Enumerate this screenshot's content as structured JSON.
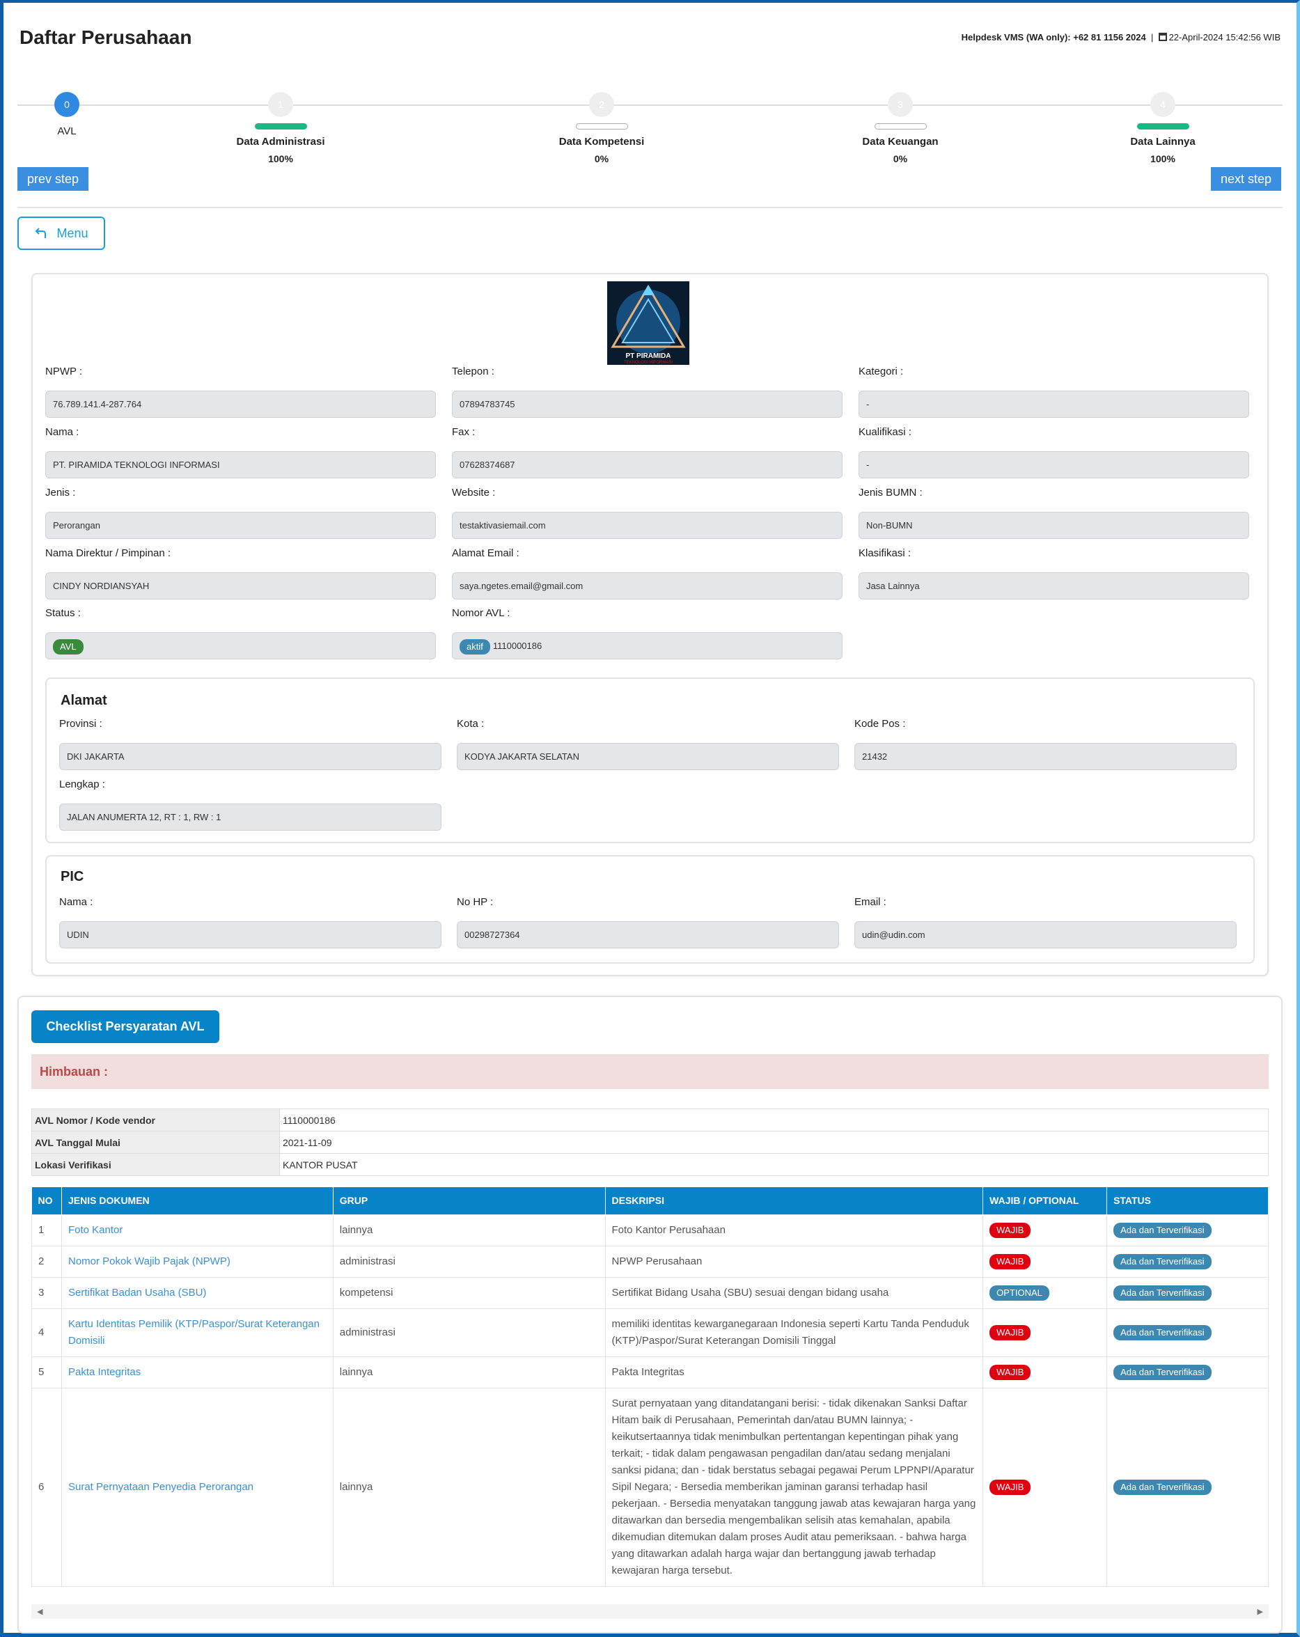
{
  "header": {
    "title": "Daftar Perusahaan",
    "helpdesk": "Helpdesk VMS (WA only): +62 81 1156 2024",
    "separator": "|",
    "datetime": "22-April-2024 15:42:56 WIB"
  },
  "stepper": {
    "steps": [
      {
        "num": "0",
        "label": "AVL",
        "percent": "",
        "progress": null,
        "active": true
      },
      {
        "num": "1",
        "label": "Data Administrasi",
        "percent": "100%",
        "progress": 100
      },
      {
        "num": "2",
        "label": "Data Kompetensi",
        "percent": "0%",
        "progress": 0
      },
      {
        "num": "3",
        "label": "Data Keuangan",
        "percent": "0%",
        "progress": 0
      },
      {
        "num": "4",
        "label": "Data Lainnya",
        "percent": "100%",
        "progress": 100
      }
    ],
    "prev": "prev step",
    "next": "next step"
  },
  "menu_label": "Menu",
  "logo": {
    "name": "PT PIRAMIDA",
    "sub": "TEKNOLOGI INFORMASI"
  },
  "company": {
    "npwp": {
      "label": "NPWP :",
      "value": "76.789.141.4-287.764"
    },
    "telepon": {
      "label": "Telepon :",
      "value": "07894783745"
    },
    "kategori": {
      "label": "Kategori :",
      "value": "-"
    },
    "nama": {
      "label": "Nama :",
      "value": "PT. PIRAMIDA TEKNOLOGI INFORMASI"
    },
    "fax": {
      "label": "Fax :",
      "value": "07628374687"
    },
    "kualifikasi": {
      "label": "Kualifikasi :",
      "value": "-"
    },
    "jenis": {
      "label": "Jenis :",
      "value": "Perorangan"
    },
    "website": {
      "label": "Website :",
      "value": "testaktivasiemail.com"
    },
    "jenis_bumn": {
      "label": "Jenis BUMN :",
      "value": "Non-BUMN"
    },
    "direktur": {
      "label": "Nama Direktur / Pimpinan :",
      "value": "CINDY NORDIANSYAH"
    },
    "email": {
      "label": "Alamat Email :",
      "value": "saya.ngetes.email@gmail.com"
    },
    "klasifikasi": {
      "label": "Klasifikasi :",
      "value": "Jasa Lainnya"
    },
    "status": {
      "label": "Status :",
      "badge": "AVL"
    },
    "nomor_avl": {
      "label": "Nomor AVL :",
      "badge": "aktif",
      "value": "1110000186"
    }
  },
  "alamat": {
    "title": "Alamat",
    "provinsi": {
      "label": "Provinsi :",
      "value": "DKI JAKARTA"
    },
    "kota": {
      "label": "Kota :",
      "value": "KODYA JAKARTA SELATAN"
    },
    "kodepos": {
      "label": "Kode Pos :",
      "value": "21432"
    },
    "lengkap": {
      "label": "Lengkap :",
      "value": "JALAN ANUMERTA 12, RT : 1, RW : 1"
    }
  },
  "pic": {
    "title": "PIC",
    "nama": {
      "label": "Nama :",
      "value": "UDIN"
    },
    "hp": {
      "label": "No HP :",
      "value": "00298727364"
    },
    "email": {
      "label": "Email :",
      "value": "udin@udin.com"
    }
  },
  "checklist": {
    "button": "Checklist Persyaratan AVL",
    "alert": "Himbauan :",
    "info": [
      [
        "AVL Nomor / Kode vendor",
        "1110000186"
      ],
      [
        "AVL Tanggal Mulai",
        "2021-11-09"
      ],
      [
        "Lokasi Verifikasi",
        "KANTOR PUSAT"
      ]
    ],
    "columns": [
      "NO",
      "JENIS DOKUMEN",
      "GRUP",
      "DESKRIPSI",
      "WAJIB / OPTIONAL",
      "STATUS"
    ],
    "rows": [
      {
        "no": "1",
        "doc": "Foto Kantor",
        "grup": "lainnya",
        "desc": "Foto Kantor Perusahaan",
        "req": "WAJIB",
        "status": "Ada dan Terverifikasi"
      },
      {
        "no": "2",
        "doc": "Nomor Pokok Wajib Pajak (NPWP)",
        "grup": "administrasi",
        "desc": "NPWP Perusahaan",
        "req": "WAJIB",
        "status": "Ada dan Terverifikasi"
      },
      {
        "no": "3",
        "doc": "Sertifikat Badan Usaha (SBU)",
        "grup": "kompetensi",
        "desc": "Sertifikat Bidang Usaha (SBU) sesuai dengan bidang usaha",
        "req": "OPTIONAL",
        "status": "Ada dan Terverifikasi"
      },
      {
        "no": "4",
        "doc": "Kartu Identitas Pemilik (KTP/Paspor/Surat Keterangan Domisili",
        "grup": "administrasi",
        "desc": "memiliki identitas kewarganegaraan Indonesia seperti Kartu Tanda Penduduk (KTP)/Paspor/Surat Keterangan Domisili Tinggal",
        "req": "WAJIB",
        "status": "Ada dan Terverifikasi"
      },
      {
        "no": "5",
        "doc": "Pakta Integritas",
        "grup": "lainnya",
        "desc": "Pakta Integritas",
        "req": "WAJIB",
        "status": "Ada dan Terverifikasi"
      },
      {
        "no": "6",
        "doc": "Surat Pernyataan Penyedia Perorangan",
        "grup": "lainnya",
        "desc": "Surat pernyataan yang ditandatangani berisi: - tidak dikenakan Sanksi Daftar Hitam baik di Perusahaan, Pemerintah dan/atau BUMN lainnya; - keikutsertaannya tidak menimbulkan pertentangan kepentingan pihak yang terkait; - tidak dalam pengawasan pengadilan dan/atau sedang menjalani sanksi pidana; dan - tidak berstatus sebagai pegawai Perum LPPNPI/Aparatur Sipil Negara; - Bersedia memberikan jaminan garansi terhadap hasil pekerjaan. - Bersedia menyatakan tanggung jawab atas kewajaran harga yang ditawarkan dan bersedia mengembalikan selisih atas kemahalan, apabila dikemudian ditemukan dalam proses Audit atau pemeriksaan. - bahwa harga yang ditawarkan adalah harga wajar dan bertanggung jawab terhadap kewajaran harga tersebut.",
        "req": "WAJIB",
        "status": "Ada dan Terverifikasi"
      }
    ]
  },
  "colors": {
    "primary": "#0784c8",
    "step_active": "#2d8ae0",
    "progress": "#14b983",
    "wajib": "#e00010",
    "status": "#3c88b0",
    "avl": "#3a8a3e"
  }
}
